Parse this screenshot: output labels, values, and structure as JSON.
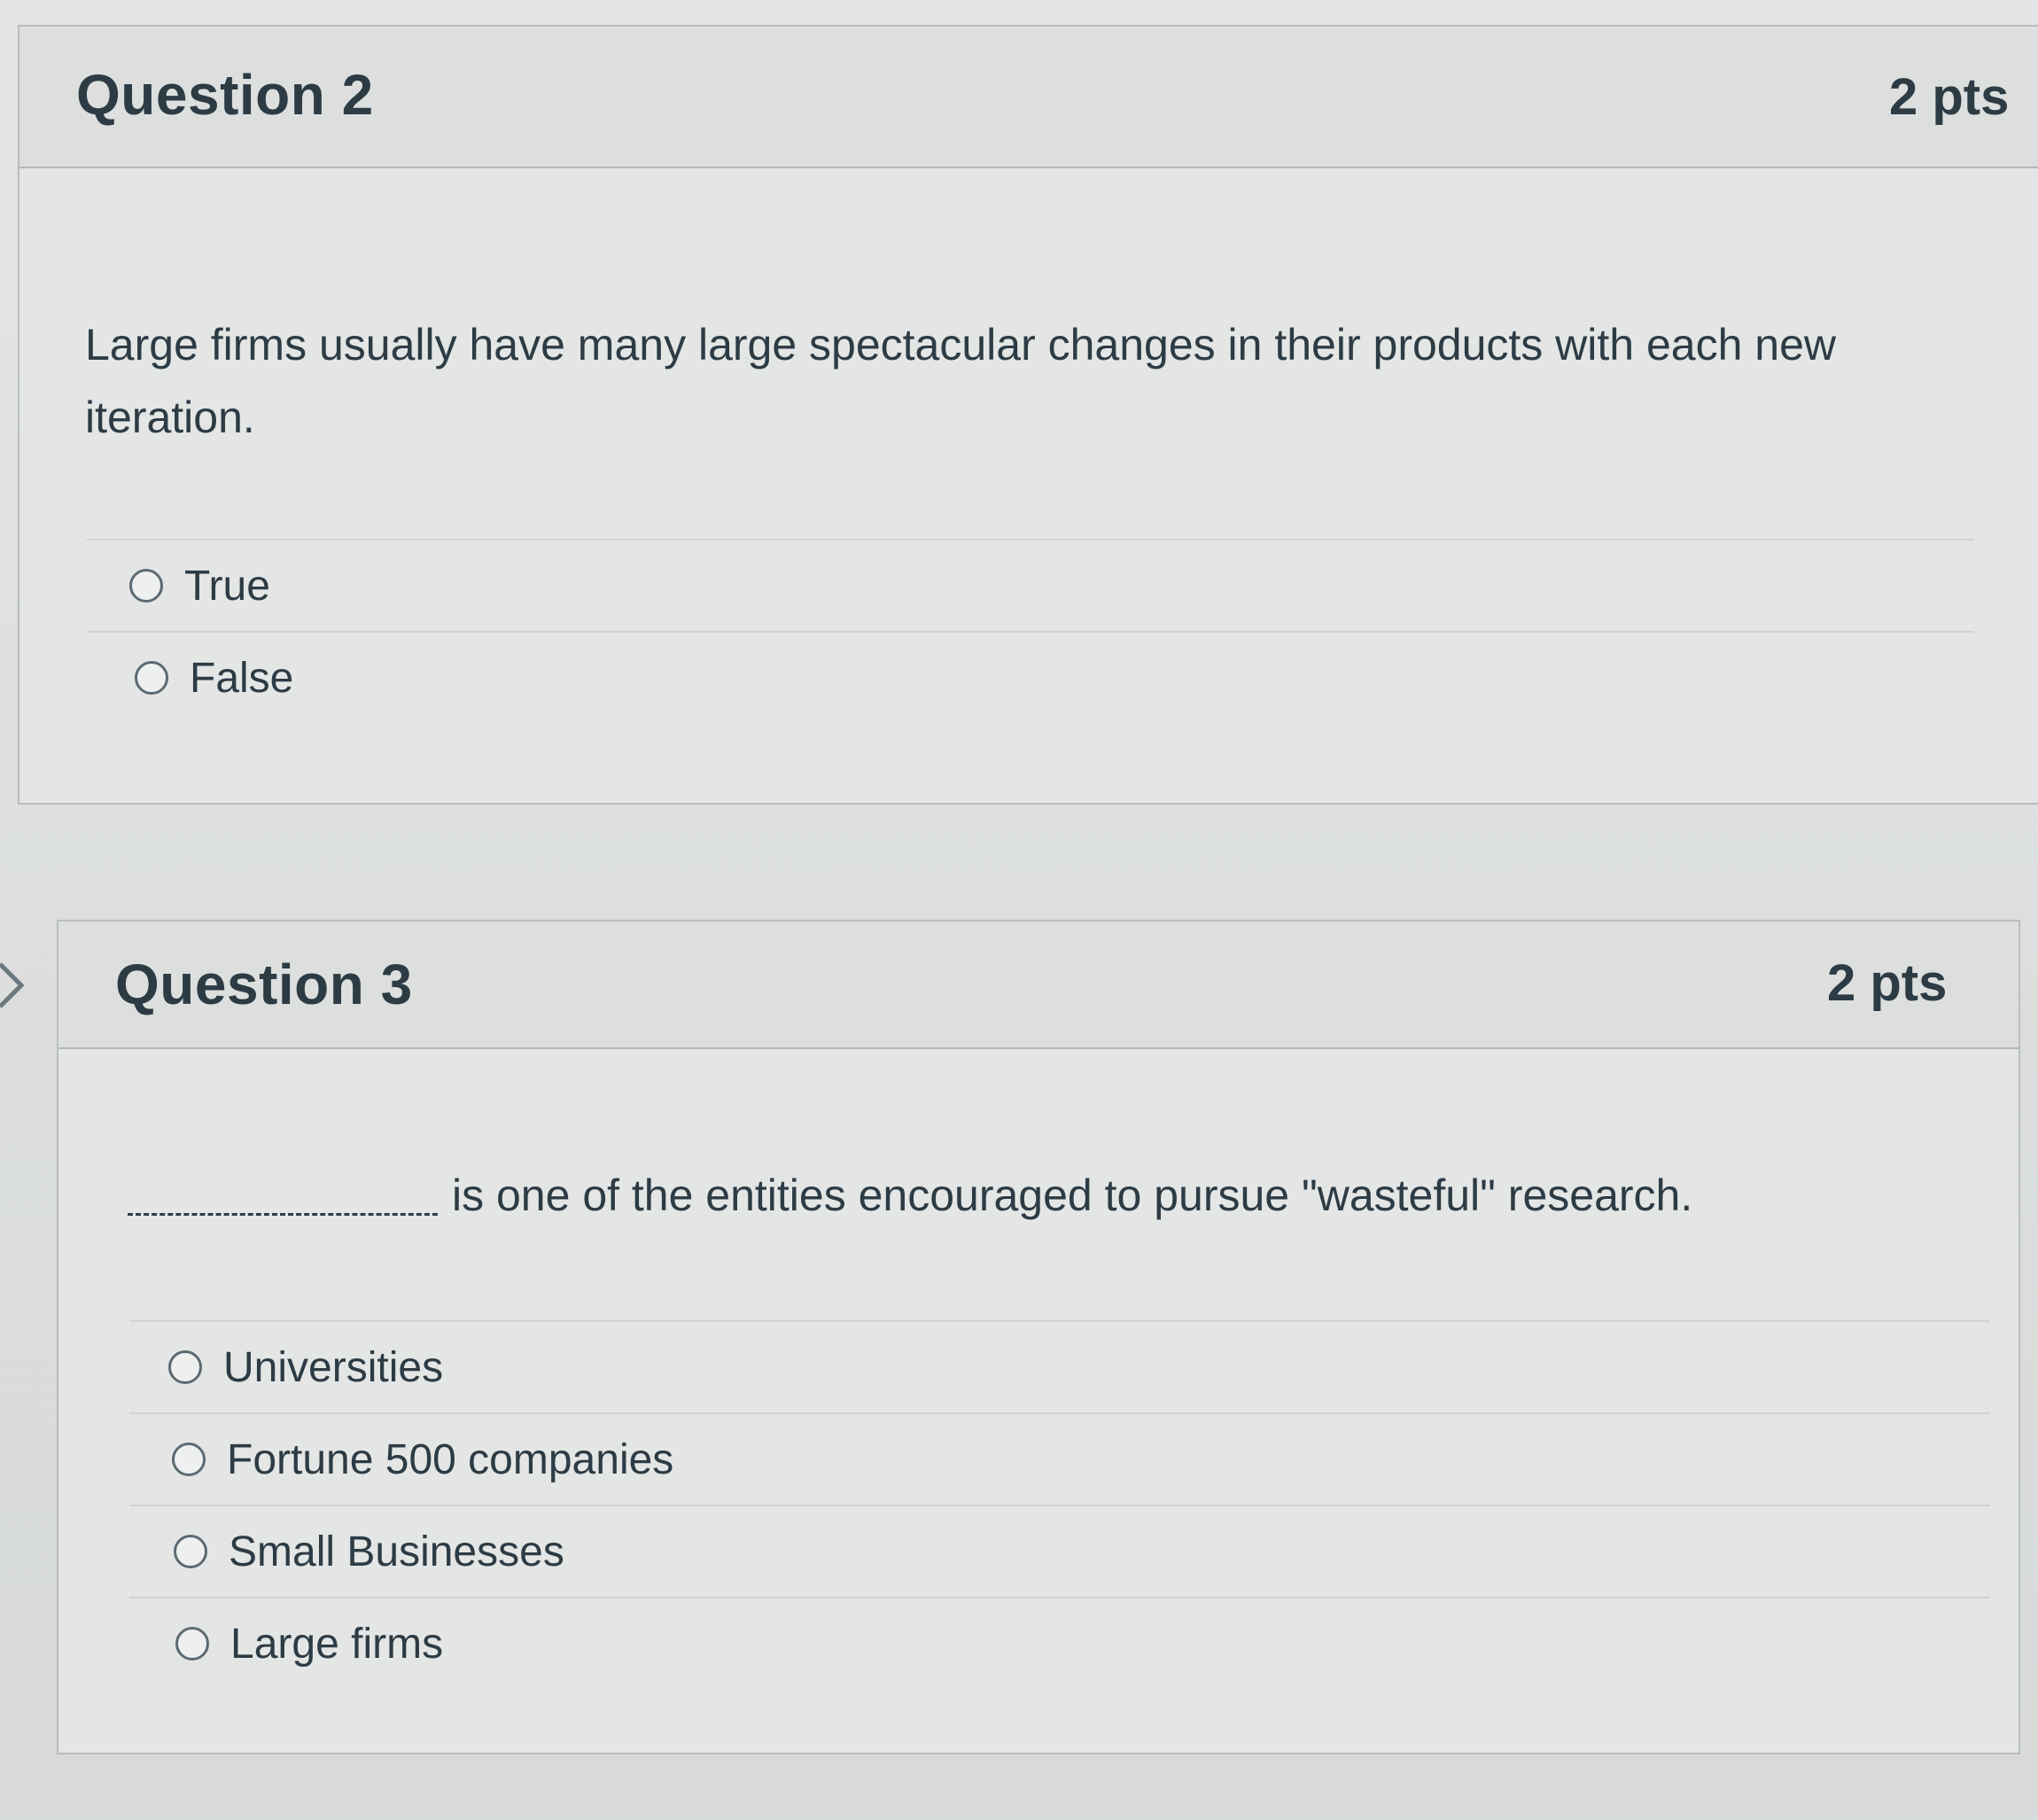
{
  "question2": {
    "title": "Question 2",
    "points": "2 pts",
    "text": "Large firms usually have many large spectacular changes in their products with each new iteration.",
    "answers": [
      {
        "label": "True"
      },
      {
        "label": "False"
      }
    ]
  },
  "question3": {
    "title": "Question 3",
    "points": "2 pts",
    "text": "is one of the entities encouraged to pursue \"wasteful\" research.",
    "answers": [
      {
        "label": "Universities"
      },
      {
        "label": "Fortune 500 companies"
      },
      {
        "label": "Small Businesses"
      },
      {
        "label": "Large firms"
      }
    ]
  },
  "icons": {
    "question_marker": "chevron-right-icon",
    "answer_option": "radio-circle-icon"
  }
}
